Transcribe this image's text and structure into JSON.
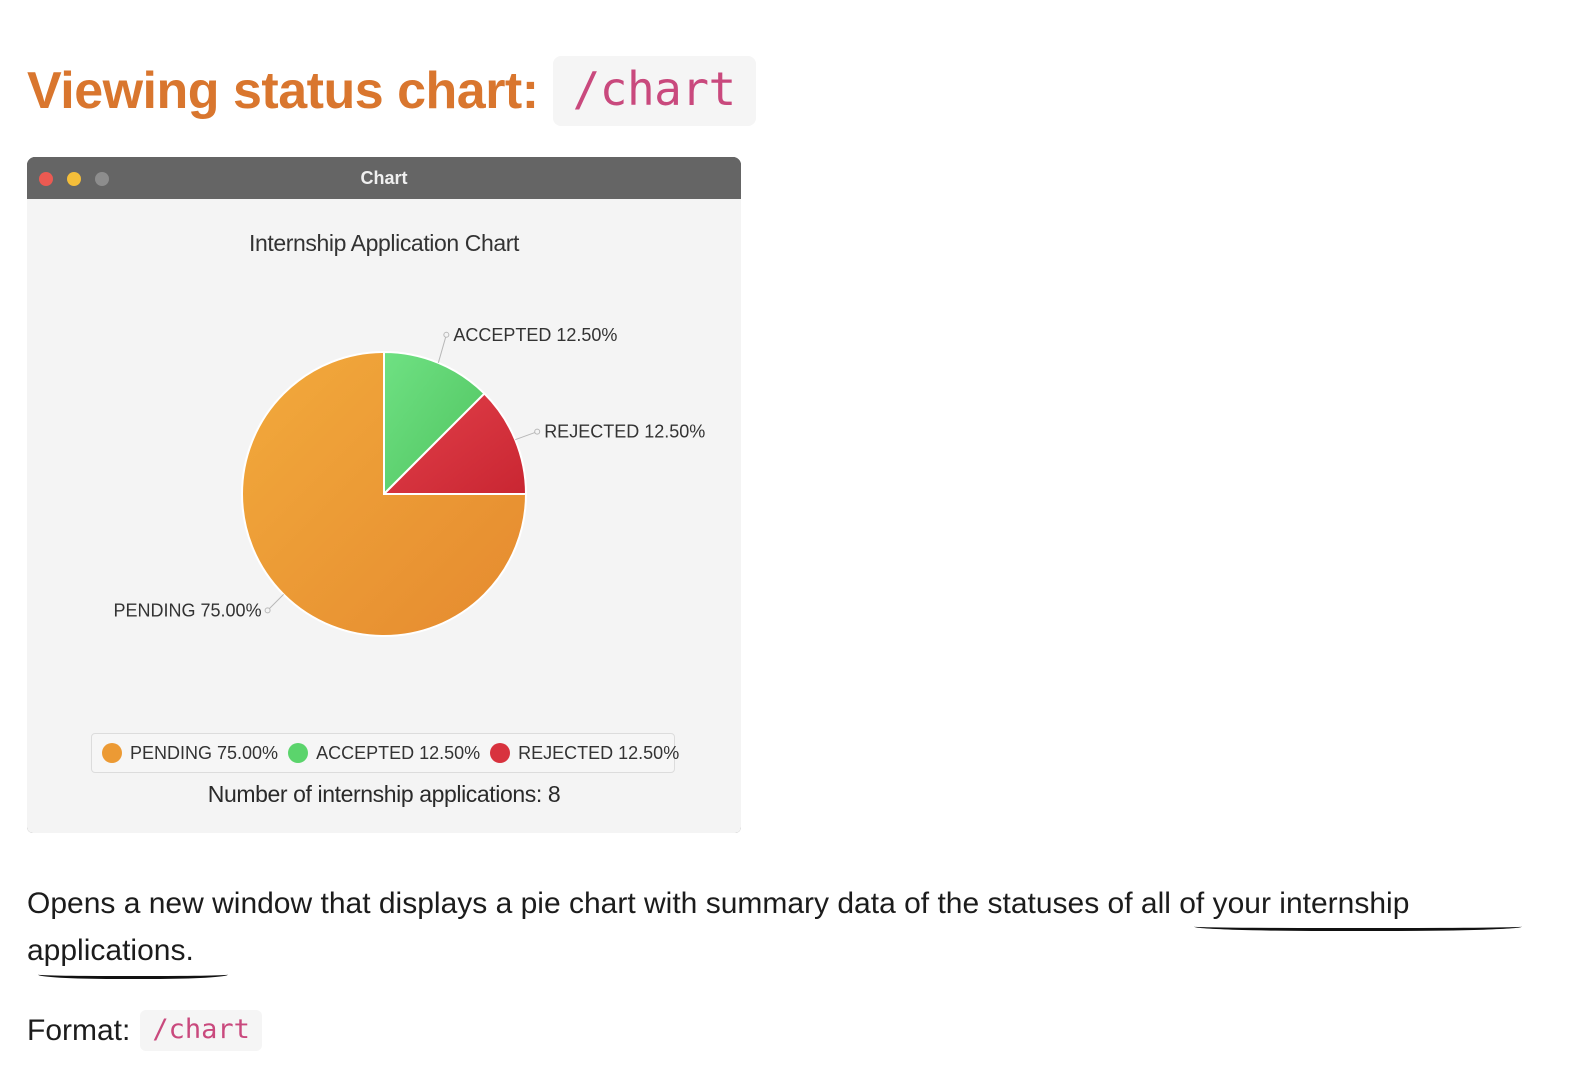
{
  "heading": {
    "text": "Viewing status chart:",
    "command": "/chart"
  },
  "window": {
    "title": "Chart",
    "controls": [
      "close-dot",
      "minimize-dot",
      "zoom-dot"
    ]
  },
  "chart_data": {
    "type": "pie",
    "title": "Internship Application Chart",
    "slices": [
      {
        "label": "ACCEPTED 12.50%",
        "name": "ACCEPTED",
        "value": 12.5,
        "color": "#5bd46c"
      },
      {
        "label": "REJECTED 12.50%",
        "name": "REJECTED",
        "value": 12.5,
        "color": "#d8323e"
      },
      {
        "label": "PENDING 75.00%",
        "name": "PENDING",
        "value": 75.0,
        "color": "#ec9a34"
      }
    ],
    "legend": [
      {
        "label": "PENDING 75.00%",
        "color": "#ec9a34"
      },
      {
        "label": "ACCEPTED 12.50%",
        "color": "#5bd46c"
      },
      {
        "label": "REJECTED 12.50%",
        "color": "#d8323e"
      }
    ],
    "legend_placement": "bottom",
    "footer": "Number of internship applications: 8"
  },
  "description": {
    "text_before": "Opens a new window that displays a pie chart with summary data of the statuses ",
    "text_underlined": "of all of your internship applications.",
    "text_after": ""
  },
  "format": {
    "label": "Format:",
    "command": "/chart"
  }
}
